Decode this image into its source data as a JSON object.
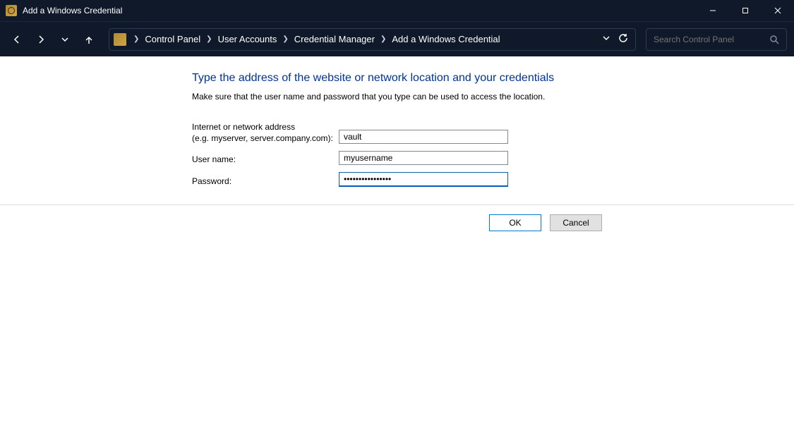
{
  "window": {
    "title": "Add a Windows Credential"
  },
  "breadcrumb": {
    "items": [
      {
        "label": "Control Panel"
      },
      {
        "label": "User Accounts"
      },
      {
        "label": "Credential Manager"
      },
      {
        "label": "Add a Windows Credential"
      }
    ]
  },
  "search": {
    "placeholder": "Search Control Panel"
  },
  "page": {
    "heading": "Type the address of the website or network location and your credentials",
    "subtext": "Make sure that the user name and password that you type can be used to access the location."
  },
  "form": {
    "address_label_line1": "Internet or network address",
    "address_label_line2": "(e.g. myserver, server.company.com):",
    "address_value": "vault",
    "username_label": "User name:",
    "username_value": "myusername",
    "password_label": "Password:",
    "password_value": "••••••••••••••••"
  },
  "buttons": {
    "ok": "OK",
    "cancel": "Cancel"
  }
}
